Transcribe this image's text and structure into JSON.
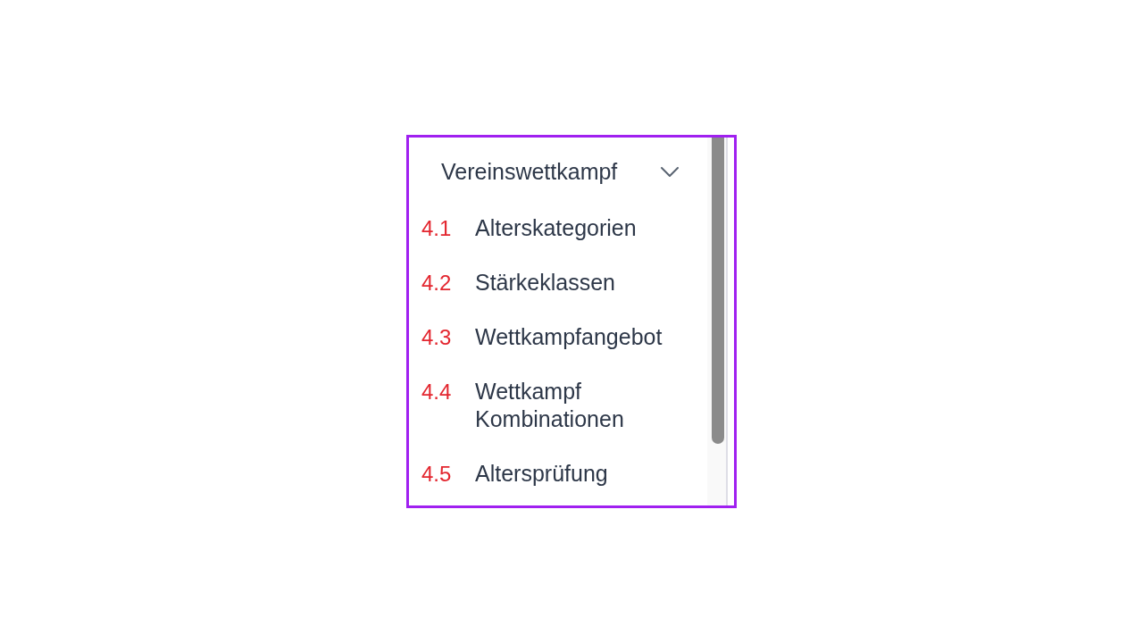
{
  "section": {
    "title": "Vereinswettkampf",
    "expanded": true,
    "items": [
      {
        "number": "4.1",
        "label": "Alterskategorien"
      },
      {
        "number": "4.2",
        "label": "Stärkeklassen"
      },
      {
        "number": "4.3",
        "label": "Wettkampfangebot"
      },
      {
        "number": "4.4",
        "label": "Wettkampf Kombinationen"
      },
      {
        "number": "4.5",
        "label": "Altersprüfung"
      }
    ]
  }
}
